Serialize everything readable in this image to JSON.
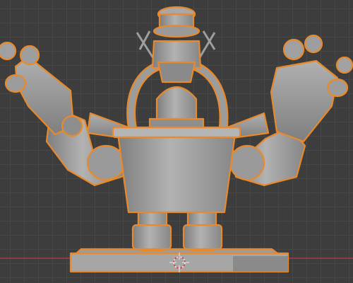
{
  "viewport": {
    "background": "#3d3d3d",
    "grid_color": "#474747",
    "x_axis_color": "#8a3a40",
    "selection_outline": "#e8892b",
    "mesh_color": "#a3a3a3",
    "mesh_shade": "#8a8a8a",
    "mesh_dark": "#6e6e6e"
  },
  "scene": {
    "object": "selected-robot-mesh",
    "cursor": "3d-cursor-icon"
  }
}
